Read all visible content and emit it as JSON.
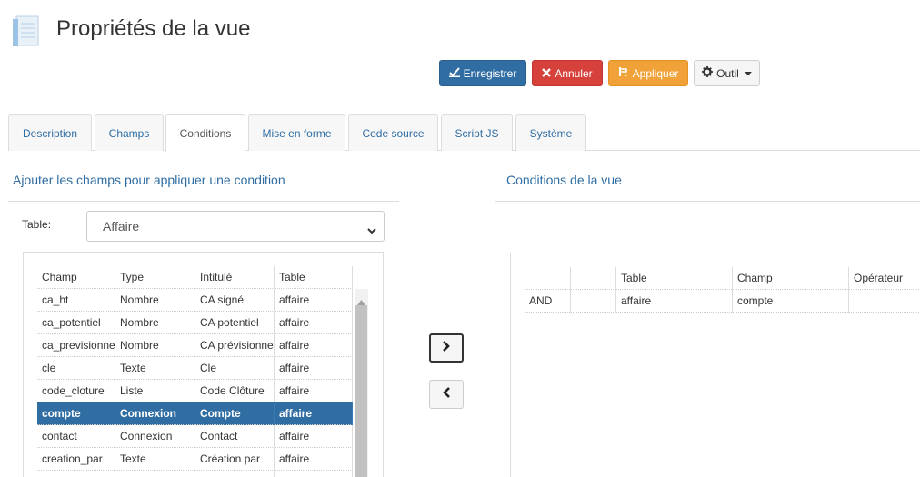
{
  "page": {
    "title": "Propriétés de la vue"
  },
  "toolbar": {
    "save_label": "Enregistrer",
    "cancel_label": "Annuler",
    "apply_label": "Appliquer",
    "tool_label": "Outil"
  },
  "tabs": [
    {
      "label": "Description"
    },
    {
      "label": "Champs"
    },
    {
      "label": "Conditions"
    },
    {
      "label": "Mise en forme"
    },
    {
      "label": "Code source"
    },
    {
      "label": "Script JS"
    },
    {
      "label": "Système"
    }
  ],
  "left_panel": {
    "title": "Ajouter les champs pour appliquer une condition",
    "table_label": "Table:",
    "table_select_value": "Affaire",
    "columns": [
      "Champ",
      "Type",
      "Intitulé",
      "Table"
    ],
    "rows": [
      [
        "ca_ht",
        "Nombre",
        "CA signé",
        "affaire"
      ],
      [
        "ca_potentiel",
        "Nombre",
        "CA potentiel",
        "affaire"
      ],
      [
        "ca_previsionnel",
        "Nombre",
        "CA prévisionnel",
        "affaire"
      ],
      [
        "cle",
        "Texte",
        "Cle",
        "affaire"
      ],
      [
        "code_cloture",
        "Liste",
        "Code Clôture",
        "affaire"
      ],
      [
        "compte",
        "Connexion",
        "Compte",
        "affaire"
      ],
      [
        "contact",
        "Connexion",
        "Contact",
        "affaire"
      ],
      [
        "creation_par",
        "Texte",
        "Création par",
        "affaire"
      ]
    ],
    "selected_row": 5
  },
  "right_panel": {
    "title": "Conditions de la vue",
    "columns": [
      "",
      "",
      "Table",
      "Champ",
      "Opérateur"
    ],
    "rows": [
      [
        "AND",
        "",
        "affaire",
        "compte",
        ""
      ]
    ]
  },
  "icons": {
    "save": "save-icon",
    "cancel": "close-icon",
    "apply": "apply-icon",
    "tool": "gear-icon",
    "add": "chevron-right-icon",
    "remove": "chevron-left-icon"
  },
  "colors": {
    "primary": "#2f6da3",
    "danger": "#d6413c",
    "warning": "#f0a238",
    "selected_row": "#2f6da3"
  }
}
